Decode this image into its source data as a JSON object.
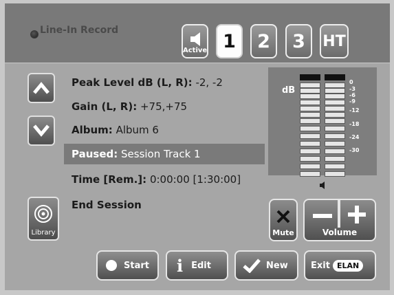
{
  "header": {
    "line_in_label": "Line-In Record",
    "speaker_button_label": "Active",
    "zones": [
      "1",
      "2",
      "3",
      "HT"
    ],
    "selected_zone": "1"
  },
  "info": {
    "peak_label": "Peak Level dB (L, R):",
    "peak_value": " -2, -2",
    "gain_label": "Gain (L, R):",
    "gain_value": " +75,+75",
    "album_label": "Album:",
    "album_value": " Album 6",
    "status_label": "Paused:",
    "status_value": " Session Track 1",
    "time_label": "Time [Rem.]:",
    "time_value": " 0:00:00 [1:30:00]",
    "end_session": "End Session"
  },
  "meter": {
    "db_label": "dB",
    "ticks": [
      "0",
      "-3",
      "-6",
      "-9",
      "-12",
      "-18",
      "-24",
      "-30"
    ],
    "left_level_db": -2,
    "right_level_db": -2
  },
  "controls": {
    "mute_label": "Mute",
    "volume_label": "Volume",
    "library_label": "Library"
  },
  "bottom_buttons": {
    "start": "Start",
    "edit": "Edit",
    "new": "New",
    "exit": "Exit",
    "brand": "ELAN"
  },
  "colors": {
    "topbar": "#797979",
    "panel": "#a6a6a6",
    "highlight": "#7a7a7a",
    "meter_bg": "#7e7e7e"
  }
}
